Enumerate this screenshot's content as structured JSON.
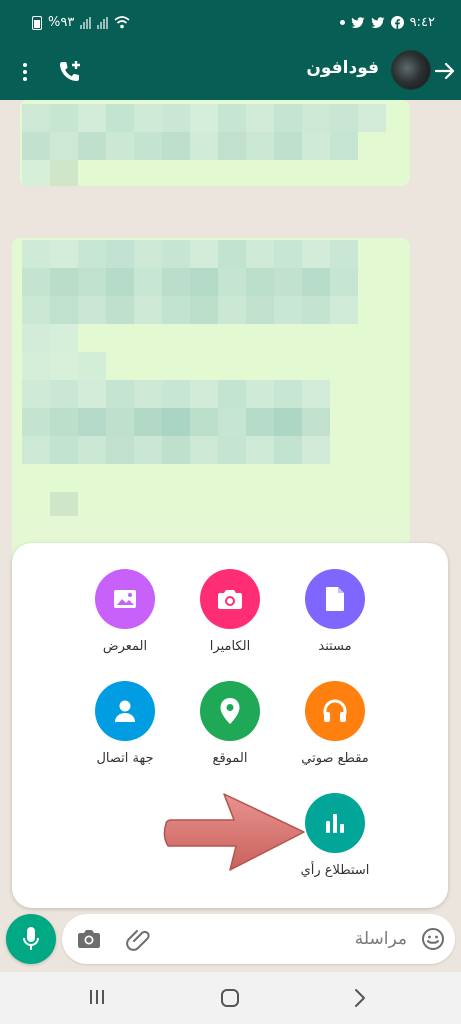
{
  "status_bar": {
    "time": "٩:٤٢",
    "battery": "%٩٣",
    "notification_icons": [
      "twitter-icon",
      "twitter-icon",
      "facebook-icon"
    ]
  },
  "header": {
    "contact_name": "فودافون",
    "color": "#075e54"
  },
  "attach_menu": {
    "items": [
      {
        "label": "مستند",
        "icon": "document-icon",
        "color": "#7f66ff"
      },
      {
        "label": "الكاميرا",
        "icon": "camera-icon",
        "color": "#ff2e74"
      },
      {
        "label": "المعرض",
        "icon": "gallery-icon",
        "color": "#c861fa"
      },
      {
        "label": "مقطع صوتي",
        "icon": "headphones-icon",
        "color": "#ff7f0f"
      },
      {
        "label": "الموقع",
        "icon": "location-pin-icon",
        "color": "#1fa855"
      },
      {
        "label": "جهة اتصال",
        "icon": "contact-person-icon",
        "color": "#009de2"
      },
      {
        "label": "استطلاع رأي",
        "icon": "poll-icon",
        "color": "#02a698"
      }
    ]
  },
  "input_bar": {
    "placeholder": "مراسلة",
    "accent": "#00a884"
  }
}
